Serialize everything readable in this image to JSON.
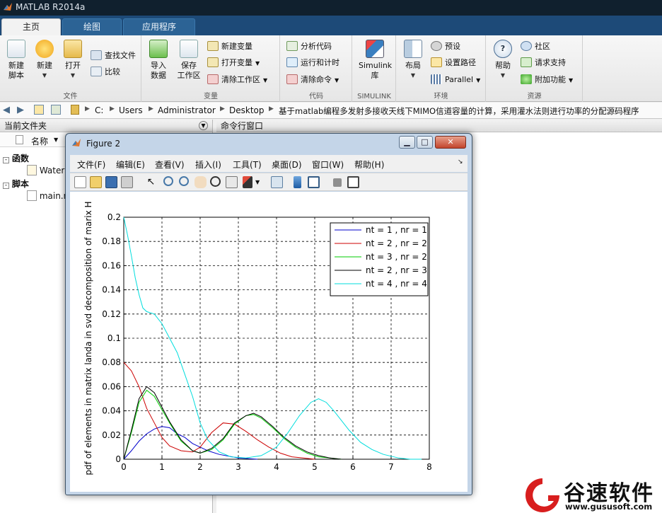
{
  "app": {
    "title": "MATLAB R2014a",
    "tabs": [
      "主页",
      "绘图",
      "应用程序"
    ]
  },
  "ribbon": {
    "groups": {
      "file": "文件",
      "variable": "变量",
      "code": "代码",
      "simulink": "SIMULINK",
      "env": "环境",
      "resources": "资源"
    },
    "new_script": [
      "新建",
      "脚本"
    ],
    "new": "新建",
    "open": "打开",
    "find_files": "查找文件",
    "compare": "比较",
    "import_data": [
      "导入",
      "数据"
    ],
    "save_workspace": [
      "保存",
      "工作区"
    ],
    "new_variable": "新建变量",
    "open_variable": "打开变量",
    "clear_workspace": "清除工作区",
    "analyze_code": "分析代码",
    "run_and_time": "运行和计时",
    "clear_commands": "清除命令",
    "simulink_library": [
      "Simulink",
      "库"
    ],
    "layout": "布局",
    "preferences": "预设",
    "set_path": "设置路径",
    "parallel": "Parallel",
    "help": "帮助",
    "community": "社区",
    "request_support": "请求支持",
    "add_ons": "附加功能"
  },
  "address": {
    "segments": [
      "C:",
      "Users",
      "Administrator",
      "Desktop",
      "基于matlab编程多发射多接收天线下MIMO信道容量的计算，采用灌水法则进行功率的分配源码程序"
    ]
  },
  "current_folder": {
    "title": "当前文件夹",
    "column_name": "名称",
    "functions_label": "函数",
    "function_file": "Water",
    "scripts_label": "脚本",
    "script_file": "main.n"
  },
  "command_window": {
    "title": "命令行窗口"
  },
  "figure": {
    "title": "Figure 2",
    "menu": [
      "文件(F)",
      "编辑(E)",
      "查看(V)",
      "插入(I)",
      "工具(T)",
      "桌面(D)",
      "窗口(W)",
      "帮助(H)"
    ]
  },
  "watermark": {
    "brand": "谷速软件",
    "url": "www.gususoft.com"
  },
  "chart_data": {
    "type": "line",
    "title": "",
    "xlabel": "",
    "ylabel": "pdf of elements in matrix landa in svd decomposition of marix H",
    "xlim": [
      0,
      8
    ],
    "ylim": [
      0,
      0.2
    ],
    "xticks": [
      "0",
      "1",
      "2",
      "3",
      "4",
      "5",
      "6",
      "7",
      "8"
    ],
    "yticks": [
      "0",
      "0.02",
      "0.04",
      "0.06",
      "0.08",
      "0.1",
      "0.12",
      "0.14",
      "0.16",
      "0.18",
      "0.2"
    ],
    "grid": "dashed",
    "legend_position": "top-right",
    "series": [
      {
        "name": "nt = 1 , nr = 1",
        "color": "#0000cc",
        "x": [
          0,
          0.2,
          0.4,
          0.6,
          0.8,
          1.0,
          1.2,
          1.4,
          1.6,
          1.8,
          2.0,
          2.2,
          2.5,
          3.0,
          3.5
        ],
        "y": [
          0,
          0.007,
          0.015,
          0.021,
          0.025,
          0.027,
          0.026,
          0.021,
          0.018,
          0.013,
          0.01,
          0.007,
          0.004,
          0.001,
          0
        ]
      },
      {
        "name": "nt = 2 , nr = 2",
        "color": "#cc0000",
        "x": [
          0,
          0.2,
          0.4,
          0.6,
          0.8,
          1.0,
          1.2,
          1.5,
          1.8,
          2.0,
          2.3,
          2.6,
          2.9,
          3.2,
          3.5,
          3.8,
          4.1,
          4.4,
          4.7,
          5.0
        ],
        "y": [
          0.08,
          0.073,
          0.06,
          0.042,
          0.03,
          0.018,
          0.011,
          0.007,
          0.006,
          0.01,
          0.022,
          0.03,
          0.029,
          0.023,
          0.016,
          0.01,
          0.005,
          0.002,
          0.001,
          0
        ]
      },
      {
        "name": "nt = 3 , nr = 2",
        "color": "#00cc00",
        "x": [
          0,
          0.2,
          0.4,
          0.6,
          0.8,
          1.0,
          1.2,
          1.5,
          1.8,
          2.0,
          2.3,
          2.6,
          2.9,
          3.2,
          3.4,
          3.6,
          3.9,
          4.2,
          4.5,
          4.8,
          5.1,
          5.4,
          5.7
        ],
        "y": [
          0,
          0.022,
          0.047,
          0.057,
          0.052,
          0.041,
          0.03,
          0.015,
          0.007,
          0.005,
          0.008,
          0.016,
          0.029,
          0.036,
          0.037,
          0.034,
          0.026,
          0.017,
          0.01,
          0.005,
          0.002,
          0.001,
          0
        ]
      },
      {
        "name": "nt = 2 , nr = 3",
        "color": "#000000",
        "x": [
          0,
          0.2,
          0.4,
          0.6,
          0.8,
          1.0,
          1.2,
          1.5,
          1.8,
          2.0,
          2.3,
          2.6,
          2.9,
          3.2,
          3.4,
          3.6,
          3.9,
          4.2,
          4.5,
          4.8,
          5.1,
          5.4,
          5.7
        ],
        "y": [
          0,
          0.024,
          0.05,
          0.06,
          0.055,
          0.043,
          0.031,
          0.016,
          0.007,
          0.005,
          0.009,
          0.017,
          0.03,
          0.036,
          0.038,
          0.035,
          0.027,
          0.018,
          0.011,
          0.006,
          0.003,
          0.001,
          0
        ]
      },
      {
        "name": "nt = 4 , nr = 4",
        "color": "#00dddd",
        "x": [
          0,
          0.1,
          0.2,
          0.3,
          0.4,
          0.5,
          0.6,
          0.8,
          1.0,
          1.2,
          1.4,
          1.6,
          1.8,
          2.0,
          2.2,
          2.5,
          2.8,
          3.2,
          3.6,
          4.0,
          4.3,
          4.6,
          4.9,
          5.1,
          5.3,
          5.5,
          5.7,
          5.9,
          6.2,
          6.5,
          6.8,
          7.2,
          7.5,
          7.7,
          7.8
        ],
        "y": [
          0.2,
          0.185,
          0.168,
          0.15,
          0.136,
          0.125,
          0.122,
          0.12,
          0.112,
          0.1,
          0.088,
          0.07,
          0.052,
          0.03,
          0.016,
          0.006,
          0.002,
          0.001,
          0.003,
          0.01,
          0.022,
          0.036,
          0.047,
          0.05,
          0.047,
          0.04,
          0.032,
          0.024,
          0.014,
          0.008,
          0.004,
          0.001,
          0,
          0,
          0
        ]
      }
    ]
  }
}
